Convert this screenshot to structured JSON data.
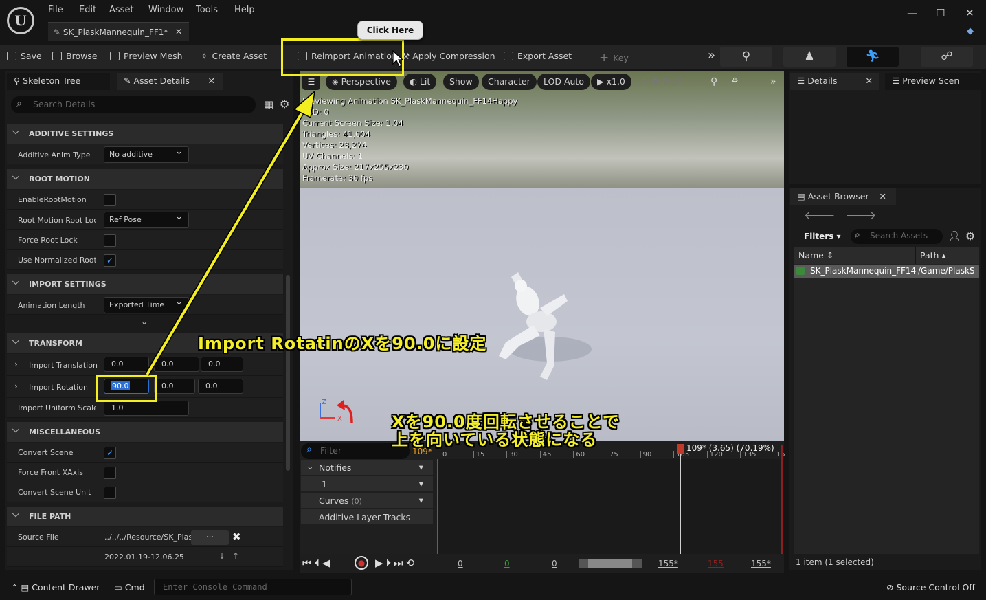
{
  "menu": [
    "File",
    "Edit",
    "Asset",
    "Window",
    "Tools",
    "Help"
  ],
  "doc_tab": "SK_PlaskMannequin_FF1*",
  "toolbar": {
    "save": "Save",
    "browse": "Browse",
    "preview_mesh": "Preview Mesh",
    "create_asset": "Create Asset",
    "reimport": "Reimport Animation",
    "apply_compression": "Apply Compression",
    "export_asset": "Export Asset",
    "key": "Key"
  },
  "callout": "Click Here",
  "left_tabs": [
    "Skeleton Tree",
    "Asset Details"
  ],
  "search_details": "Search Details",
  "sections": {
    "additive": "ADDITIVE SETTINGS",
    "root_motion": "ROOT MOTION",
    "import": "IMPORT SETTINGS",
    "transform": "TRANSFORM",
    "misc": "MISCELLANEOUS",
    "file_path": "FILE PATH"
  },
  "props": {
    "additive_anim_type": {
      "label": "Additive Anim Type",
      "value": "No additive"
    },
    "enable_root_motion": "EnableRootMotion",
    "root_motion_lock": {
      "label": "Root Motion Root Lock",
      "value": "Ref Pose"
    },
    "force_root_lock": "Force Root Lock",
    "use_normalized": "Use Normalized Root M",
    "animation_length": {
      "label": "Animation Length",
      "value": "Exported Time"
    },
    "import_translation": {
      "label": "Import Translation",
      "x": "0.0",
      "y": "0.0",
      "z": "0.0"
    },
    "import_rotation": {
      "label": "Import Rotation",
      "x": "90.0",
      "y": "0.0",
      "z": "0.0"
    },
    "import_uniform_scale": {
      "label": "Import Uniform Scale",
      "value": "1.0"
    },
    "convert_scene": "Convert Scene",
    "force_front_xaxis": "Force Front XAxis",
    "convert_scene_unit": "Convert Scene Unit",
    "source_file": {
      "label": "Source File",
      "value": "../../../Resource/SK_Plas",
      "browse": "...",
      "timestamp": "2022.01.19-12.06.25"
    }
  },
  "viewport": {
    "buttons": [
      "Perspective",
      "Lit",
      "Show",
      "Character",
      "LOD Auto",
      "x1.0"
    ],
    "stats": [
      "Previewing Animation SK_PlaskMannequin_FF14Happy",
      "LOD: 0",
      "Current Screen Size: 1.04",
      "Triangles: 41,004",
      "Vertices: 23,274",
      "UV Channels: 1",
      "Approx Size: 217x255x230",
      "Framerate: 30 fps"
    ]
  },
  "annotations": {
    "rotation_note": "Import RotatinのXを90.0に設定",
    "result_line1": "Xを90.0度回転させることで",
    "result_line2": "上を向いている状態になる"
  },
  "timeline": {
    "filter": "Filter",
    "frame": "109*",
    "tracks": [
      "Notifies",
      "1",
      "Curves",
      "Additive Layer Tracks"
    ],
    "curves_count": "(0)",
    "playhead": "109* (3.65) (70.19%)",
    "ticks": [
      "0",
      "15",
      "30",
      "45",
      "60",
      "75",
      "90",
      "105",
      "120",
      "135",
      "15"
    ],
    "transport": [
      "0",
      "0",
      "0",
      "155*",
      "155",
      "155*"
    ]
  },
  "right": {
    "details_tab": "Details",
    "preview_tab": "Preview Scen",
    "asset_browser": "Asset Browser",
    "filters": "Filters",
    "search_assets": "Search Assets",
    "col_name": "Name",
    "col_path": "Path",
    "asset_name": "SK_PlaskMannequin_FF14",
    "asset_path": "/Game/PlaskS",
    "count": "1 item (1 selected)"
  },
  "status": {
    "content_drawer": "Content Drawer",
    "cmd": "Cmd",
    "console_placeholder": "Enter Console Command",
    "source_control": "Source Control Off"
  },
  "colors": {
    "highlight": "#f2ee20",
    "accent_blue": "#4aa0ff",
    "bg": "#151515"
  }
}
